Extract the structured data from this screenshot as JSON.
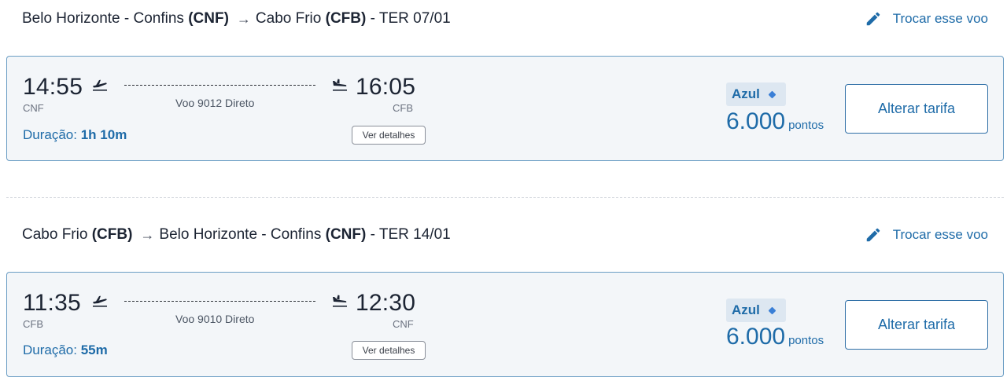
{
  "legs": [
    {
      "origin_city": "Belo Horizonte - Confins",
      "origin_code_paren": "(CNF)",
      "arrow": "→",
      "destination_city": "Cabo Frio",
      "destination_code_paren": "(CFB)",
      "date": "- TER 07/01",
      "change_label": "Trocar esse voo",
      "departure_time": "14:55",
      "departure_code": "CNF",
      "arrival_time": "16:05",
      "arrival_code": "CFB",
      "flight_info": "Voo 9012 Direto",
      "duration_label": "Duração:",
      "duration_value": "1h 10m",
      "details_label": "Ver detalhes",
      "fare_name": "Azul",
      "points_value": "6.000",
      "points_unit": "pontos",
      "fare_button": "Alterar tarifa"
    },
    {
      "origin_city": "Cabo Frio",
      "origin_code_paren": "(CFB)",
      "arrow": "→",
      "destination_city": "Belo Horizonte - Confins",
      "destination_code_paren": "(CNF)",
      "date": "- TER 14/01",
      "change_label": "Trocar esse voo",
      "departure_time": "11:35",
      "departure_code": "CFB",
      "arrival_time": "12:30",
      "arrival_code": "CNF",
      "flight_info": "Voo 9010 Direto",
      "duration_label": "Duração:",
      "duration_value": "55m",
      "details_label": "Ver detalhes",
      "fare_name": "Azul",
      "points_value": "6.000",
      "points_unit": "pontos",
      "fare_button": "Alterar tarifa"
    }
  ],
  "icons": {
    "edit": "pencil-icon",
    "departure": "plane-takeoff-icon",
    "arrival": "plane-landing-icon",
    "fare_marker": "diamond-icon"
  },
  "colors": {
    "accent": "#1e6ba8",
    "card_bg": "#f3f6f9",
    "card_border": "#6a9dc4",
    "badge_bg": "#dde7f1"
  }
}
